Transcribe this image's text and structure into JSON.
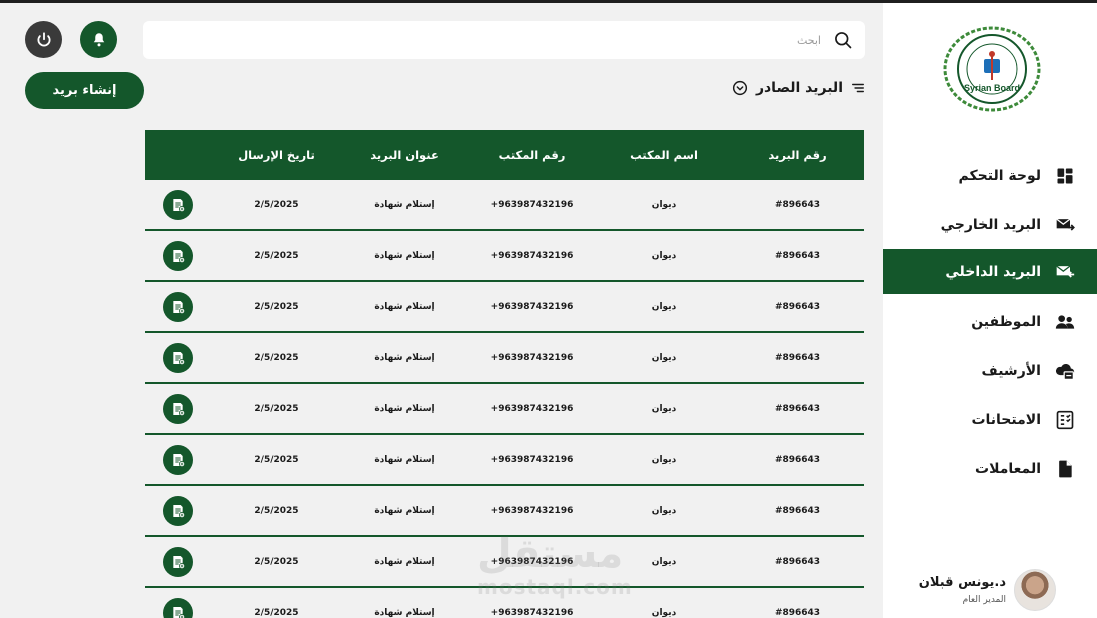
{
  "search": {
    "placeholder": "ابحث",
    "value": ""
  },
  "toolbar": {
    "create_label": "إنشاء بريد",
    "power_icon": "power-icon",
    "bell_icon": "bell-icon"
  },
  "section": {
    "title": "البريد الصادر"
  },
  "sidebar": {
    "logo_text": "Syrian Board",
    "items": [
      {
        "label": "لوحة التحكم",
        "icon": "dashboard-icon",
        "active": false
      },
      {
        "label": "البريد الخارجي",
        "icon": "mail-out-icon",
        "active": false
      },
      {
        "label": "البريد الداخلي",
        "icon": "mail-in-icon",
        "active": true
      },
      {
        "label": "الموظفين",
        "icon": "users-icon",
        "active": false
      },
      {
        "label": "الأرشيف",
        "icon": "archive-icon",
        "active": false
      },
      {
        "label": "الامتحانات",
        "icon": "exams-icon",
        "active": false
      },
      {
        "label": "المعاملات",
        "icon": "transactions-icon",
        "active": false
      }
    ]
  },
  "user": {
    "name": "د.يونس قبلان",
    "role": "المدير العام"
  },
  "table": {
    "columns": [
      "رقم البريد",
      "اسم المكتب",
      "رقم المكتب",
      "عنوان البريد",
      "تاريخ الإرسال"
    ],
    "rows": [
      {
        "id": "#896643",
        "office": "ديوان",
        "phone": "+963987432196",
        "subject": "إستلام شهادة",
        "date": "2/5/2025"
      },
      {
        "id": "#896643",
        "office": "ديوان",
        "phone": "+963987432196",
        "subject": "إستلام شهادة",
        "date": "2/5/2025"
      },
      {
        "id": "#896643",
        "office": "ديوان",
        "phone": "+963987432196",
        "subject": "إستلام شهادة",
        "date": "2/5/2025"
      },
      {
        "id": "#896643",
        "office": "ديوان",
        "phone": "+963987432196",
        "subject": "إستلام شهادة",
        "date": "2/5/2025"
      },
      {
        "id": "#896643",
        "office": "ديوان",
        "phone": "+963987432196",
        "subject": "إستلام شهادة",
        "date": "2/5/2025"
      },
      {
        "id": "#896643",
        "office": "ديوان",
        "phone": "+963987432196",
        "subject": "إستلام شهادة",
        "date": "2/5/2025"
      },
      {
        "id": "#896643",
        "office": "ديوان",
        "phone": "+963987432196",
        "subject": "إستلام شهادة",
        "date": "2/5/2025"
      },
      {
        "id": "#896643",
        "office": "ديوان",
        "phone": "+963987432196",
        "subject": "إستلام شهادة",
        "date": "2/5/2025"
      },
      {
        "id": "#896643",
        "office": "ديوان",
        "phone": "+963987432196",
        "subject": "إستلام شهادة",
        "date": "2/5/2025"
      }
    ]
  },
  "watermark": {
    "arabic": "مستقل",
    "latin": "mostaql.com"
  },
  "colors": {
    "primary": "#14572b",
    "dark": "#3a3a3a",
    "background": "#f1f1f1"
  }
}
